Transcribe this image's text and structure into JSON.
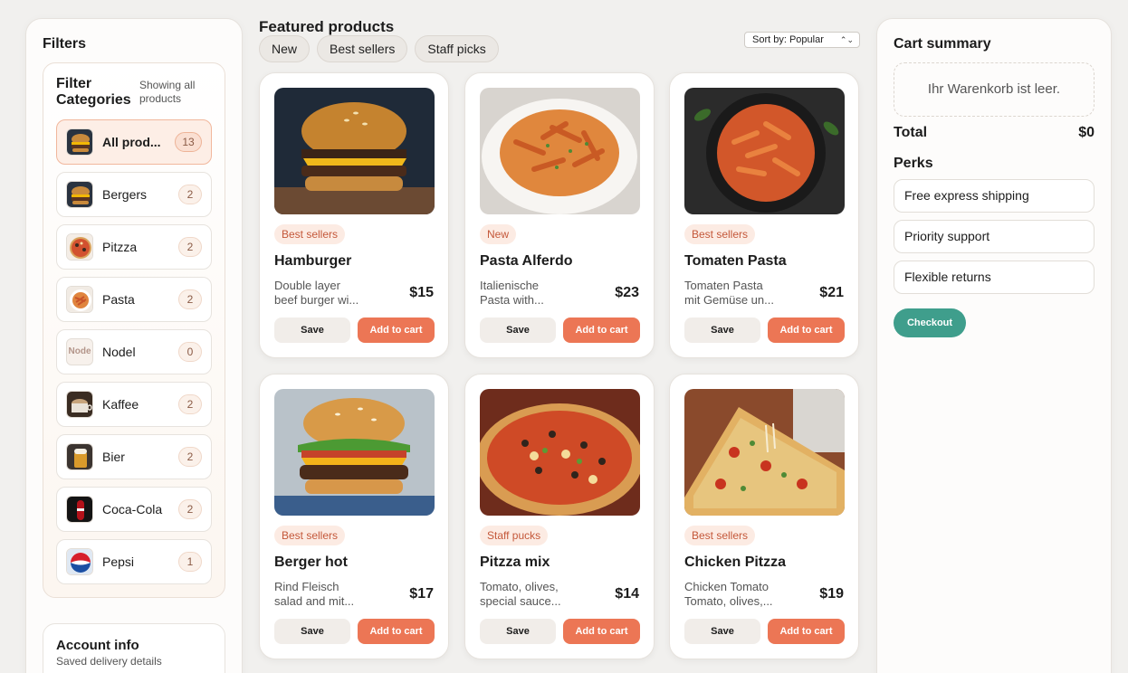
{
  "sidebar": {
    "title": "Filters",
    "categories_heading": "Filter Categories",
    "categories_status": "Showing all products",
    "categories": [
      {
        "label": "All prod...",
        "count": "13",
        "thumb": "burger-thumb",
        "active": true
      },
      {
        "label": "Bergers",
        "count": "2",
        "thumb": "burger-thumb"
      },
      {
        "label": "Pitzza",
        "count": "2",
        "thumb": "pizza-thumb"
      },
      {
        "label": "Pasta",
        "count": "2",
        "thumb": "pasta-thumb"
      },
      {
        "label": "Nodel",
        "count": "0",
        "thumb": "Node"
      },
      {
        "label": "Kaffee",
        "count": "2",
        "thumb": "coffee-thumb"
      },
      {
        "label": "Bier",
        "count": "2",
        "thumb": "beer-thumb"
      },
      {
        "label": "Coca-Cola",
        "count": "2",
        "thumb": "cola-thumb"
      },
      {
        "label": "Pepsi",
        "count": "1",
        "thumb": "pepsi-thumb"
      }
    ],
    "account": {
      "title": "Account info",
      "subtitle": "Saved delivery details"
    }
  },
  "main": {
    "title": "Featured products",
    "tabs": [
      "New",
      "Best sellers",
      "Staff picks"
    ],
    "sort_label": "Sort by: Popular",
    "save_label": "Save",
    "add_label": "Add to cart",
    "products": [
      {
        "name": "Hamburger",
        "badge": "Best sellers",
        "desc1": "Double layer",
        "desc2": "beef burger wi...",
        "price": "$15",
        "image": "burger"
      },
      {
        "name": "Pasta Alferdo",
        "badge": "New",
        "desc1": "Italienische",
        "desc2": "Pasta with...",
        "price": "$23",
        "image": "pasta-plate"
      },
      {
        "name": "Tomaten Pasta",
        "badge": "Best sellers",
        "desc1": "Tomaten Pasta",
        "desc2": "mit Gemüse un...",
        "price": "$21",
        "image": "pasta-pan"
      },
      {
        "name": "Berger hot",
        "badge": "Best sellers",
        "desc1": "Rind Fleisch",
        "desc2": "salad and mit...",
        "price": "$17",
        "image": "burger"
      },
      {
        "name": "Pitzza mix",
        "badge": "Staff pucks",
        "desc1": "Tomato, olives,",
        "desc2": "special sauce...",
        "price": "$14",
        "image": "pizza"
      },
      {
        "name": "Chicken Pitzza",
        "badge": "Best sellers",
        "desc1": "Chicken Tomato",
        "desc2": "Tomato, olives,...",
        "price": "$19",
        "image": "pizza"
      }
    ]
  },
  "cart": {
    "title": "Cart summary",
    "empty_message": "Ihr Warenkorb ist leer.",
    "total_label": "Total",
    "total_value": "$0",
    "perks_title": "Perks",
    "perks": [
      "Free express shipping",
      "Priority support",
      "Flexible returns"
    ],
    "checkout_label": "Checkout"
  },
  "colors": {
    "accent": "#ec7655",
    "checkout": "#3f9e8c",
    "badge_text": "#c4583a",
    "background": "#f1f0ee"
  }
}
